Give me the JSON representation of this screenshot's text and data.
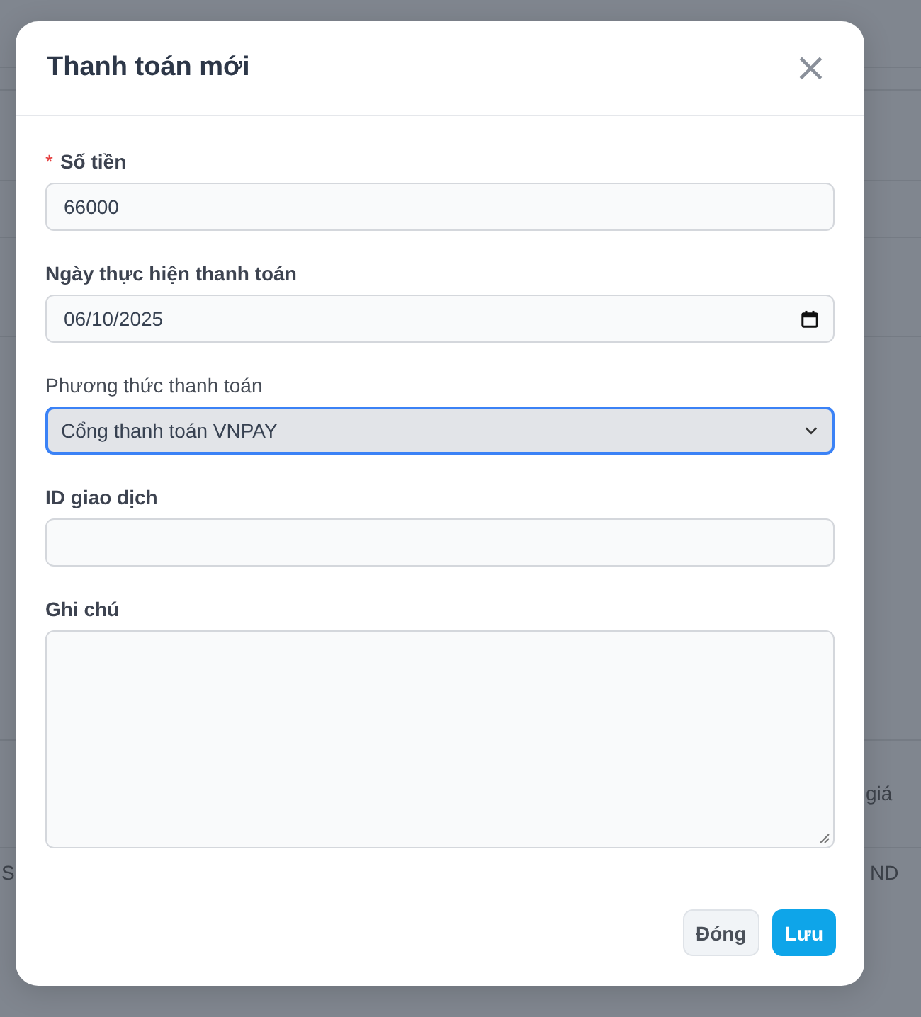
{
  "background": {
    "texts": [
      "giá",
      "S",
      "ND"
    ]
  },
  "dialog": {
    "title": "Thanh toán mới",
    "close": "×",
    "required_sign": "*",
    "fields": [
      {
        "kind": "text",
        "label": "Số tiền",
        "required": true,
        "value": "66000",
        "focused": false
      },
      {
        "kind": "date",
        "label": "Ngày thực hiện thanh toán",
        "required": false,
        "value": "06/10/2025",
        "focused": false
      },
      {
        "kind": "select",
        "label": "Phương thức thanh toán",
        "required": false,
        "value": "Cổng thanh toán VNPAY",
        "focused": true
      },
      {
        "kind": "text",
        "label": "ID giao dịch",
        "required": false,
        "focused": false
      },
      {
        "kind": "textarea",
        "label": "Ghi chú",
        "required": false,
        "focused": false
      }
    ],
    "buttons": [
      {
        "label": "Đóng",
        "kind": "secondary"
      },
      {
        "label": "Lưu",
        "kind": "primary"
      }
    ]
  }
}
